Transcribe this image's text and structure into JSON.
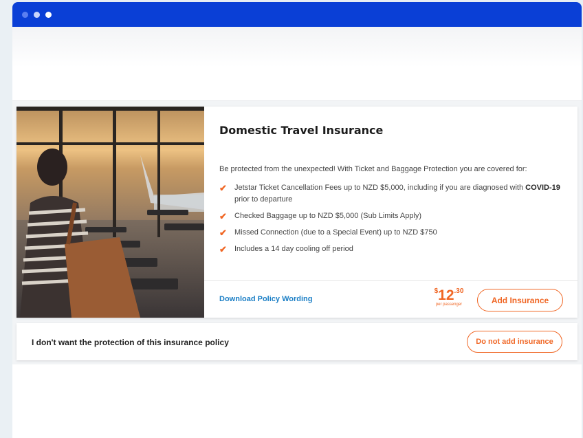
{
  "window": {
    "dots": [
      "#5b7ff0",
      "#c9d5fb",
      "#ffffff"
    ]
  },
  "product": {
    "title": "Domestic Travel Insurance",
    "intro": "Be protected from the unexpected! With Ticket and Baggage Protection you are covered for:",
    "features": [
      {
        "text": "Jetstar Ticket Cancellation Fees up to NZD $5,000, including if you are diagnosed with ",
        "bold": "COVID-19",
        "after": " prior to departure"
      },
      {
        "text": "Checked Baggage up to NZD $5,000 (Sub Limits Apply)",
        "bold": "",
        "after": ""
      },
      {
        "text": "Missed Connection (due to a Special Event) up to NZD $750",
        "bold": "",
        "after": ""
      },
      {
        "text": "Includes a 14 day cooling off period",
        "bold": "",
        "after": ""
      }
    ],
    "check_icon": "check-icon",
    "download_label": "Download Policy Wording",
    "price": {
      "currency": "$",
      "whole": "12",
      "cents": ".30",
      "per": "per passenger"
    },
    "add_label": "Add Insurance",
    "accent_color": "#f06624",
    "link_color": "#1a7ec5"
  },
  "decline": {
    "text": "I don't want the protection of this insurance policy",
    "button_label": "Do not add insurance"
  },
  "colors": {
    "titlebar": "#0a3fd6"
  }
}
